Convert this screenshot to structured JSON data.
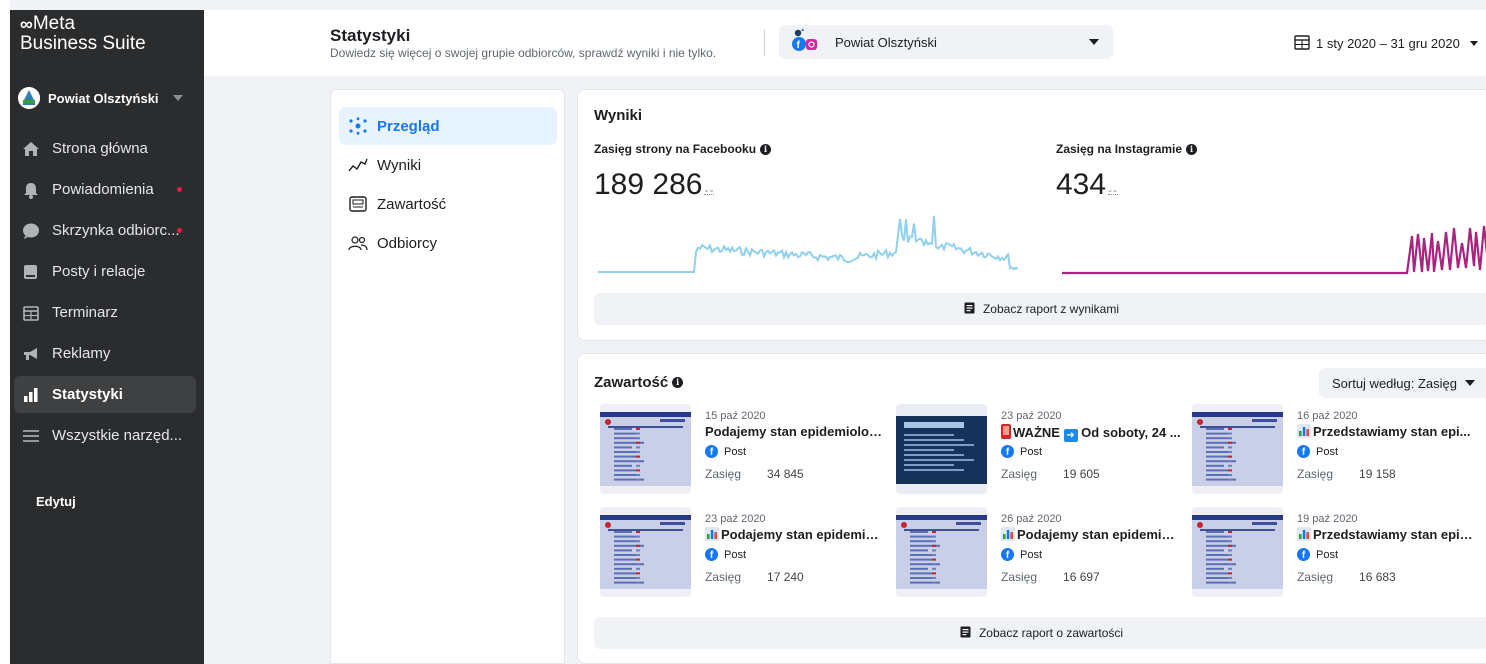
{
  "brand": {
    "line1": "Meta",
    "line2": "Business Suite"
  },
  "account": {
    "name": "Powiat Olsztyński"
  },
  "nav": {
    "items": [
      {
        "label": "Strona główna",
        "icon": "home-icon",
        "dot": false
      },
      {
        "label": "Powiadomienia",
        "icon": "bell-icon",
        "dot": true
      },
      {
        "label": "Skrzynka odbiorc...",
        "icon": "chat-bubble-icon",
        "dot": true
      },
      {
        "label": "Posty i relacje",
        "icon": "posts-icon",
        "dot": false
      },
      {
        "label": "Terminarz",
        "icon": "calendar-icon",
        "dot": false
      },
      {
        "label": "Reklamy",
        "icon": "megaphone-icon",
        "dot": false
      },
      {
        "label": "Statystyki",
        "icon": "bar-chart-icon",
        "dot": false,
        "active": true
      },
      {
        "label": "Wszystkie narzęd...",
        "icon": "menu-icon",
        "dot": false
      }
    ],
    "edit_label": "Edytuj"
  },
  "header": {
    "title": "Statystyki",
    "subtitle": "Dowiedz się więcej o swojej grupie odbiorców, sprawdź wyniki i nie tylko.",
    "page_select": "Powiat Olsztyński",
    "date_range": "1 sty 2020 – 31 gru 2020"
  },
  "subnav": {
    "items": [
      {
        "label": "Przegląd",
        "icon": "overview-icon",
        "active": true
      },
      {
        "label": "Wyniki",
        "icon": "trend-icon"
      },
      {
        "label": "Zawartość",
        "icon": "content-icon"
      },
      {
        "label": "Odbiorcy",
        "icon": "audience-icon"
      }
    ]
  },
  "results": {
    "title": "Wyniki",
    "facebook": {
      "label": "Zasięg strony na Facebooku",
      "value": "189 286",
      "dash": "--"
    },
    "instagram": {
      "label": "Zasięg na Instagramie",
      "value": "434",
      "dash": "--"
    },
    "report_button": "Zobacz raport z wynikami"
  },
  "content": {
    "title": "Zawartość",
    "sort_label": "Sortuj według: Zasięg",
    "reach_label": "Zasięg",
    "posts": [
      {
        "date": "15 paź 2020",
        "title": "Podajemy stan epidemiologi...",
        "type": "Post",
        "reach": "34 845",
        "emoji": "",
        "thumb": "table"
      },
      {
        "date": "23 paź 2020",
        "title": "WAŻNE ➡ Od soboty, 24 ...",
        "type": "Post",
        "reach": "19 605",
        "emoji": "phone",
        "thumb": "dark"
      },
      {
        "date": "16 paź 2020",
        "title": "Przedstawiamy stan epi...",
        "type": "Post",
        "reach": "19 158",
        "emoji": "chart",
        "thumb": "table"
      },
      {
        "date": "23 paź 2020",
        "title": "Podajemy stan epidemiol...",
        "type": "Post",
        "reach": "17 240",
        "emoji": "chart",
        "thumb": "table"
      },
      {
        "date": "26 paź 2020",
        "title": "Podajemy stan epidemiol...",
        "type": "Post",
        "reach": "16 697",
        "emoji": "chart",
        "thumb": "table"
      },
      {
        "date": "19 paź 2020",
        "title": "Przedstawiamy stan epid...",
        "type": "Post",
        "reach": "16 683",
        "emoji": "chart",
        "thumb": "table"
      }
    ],
    "report_button": "Zobacz raport o zawartości"
  },
  "colors": {
    "facebook_line": "#8fd0ee",
    "instagram_line": "#a8247f",
    "accent": "#1877f2"
  }
}
